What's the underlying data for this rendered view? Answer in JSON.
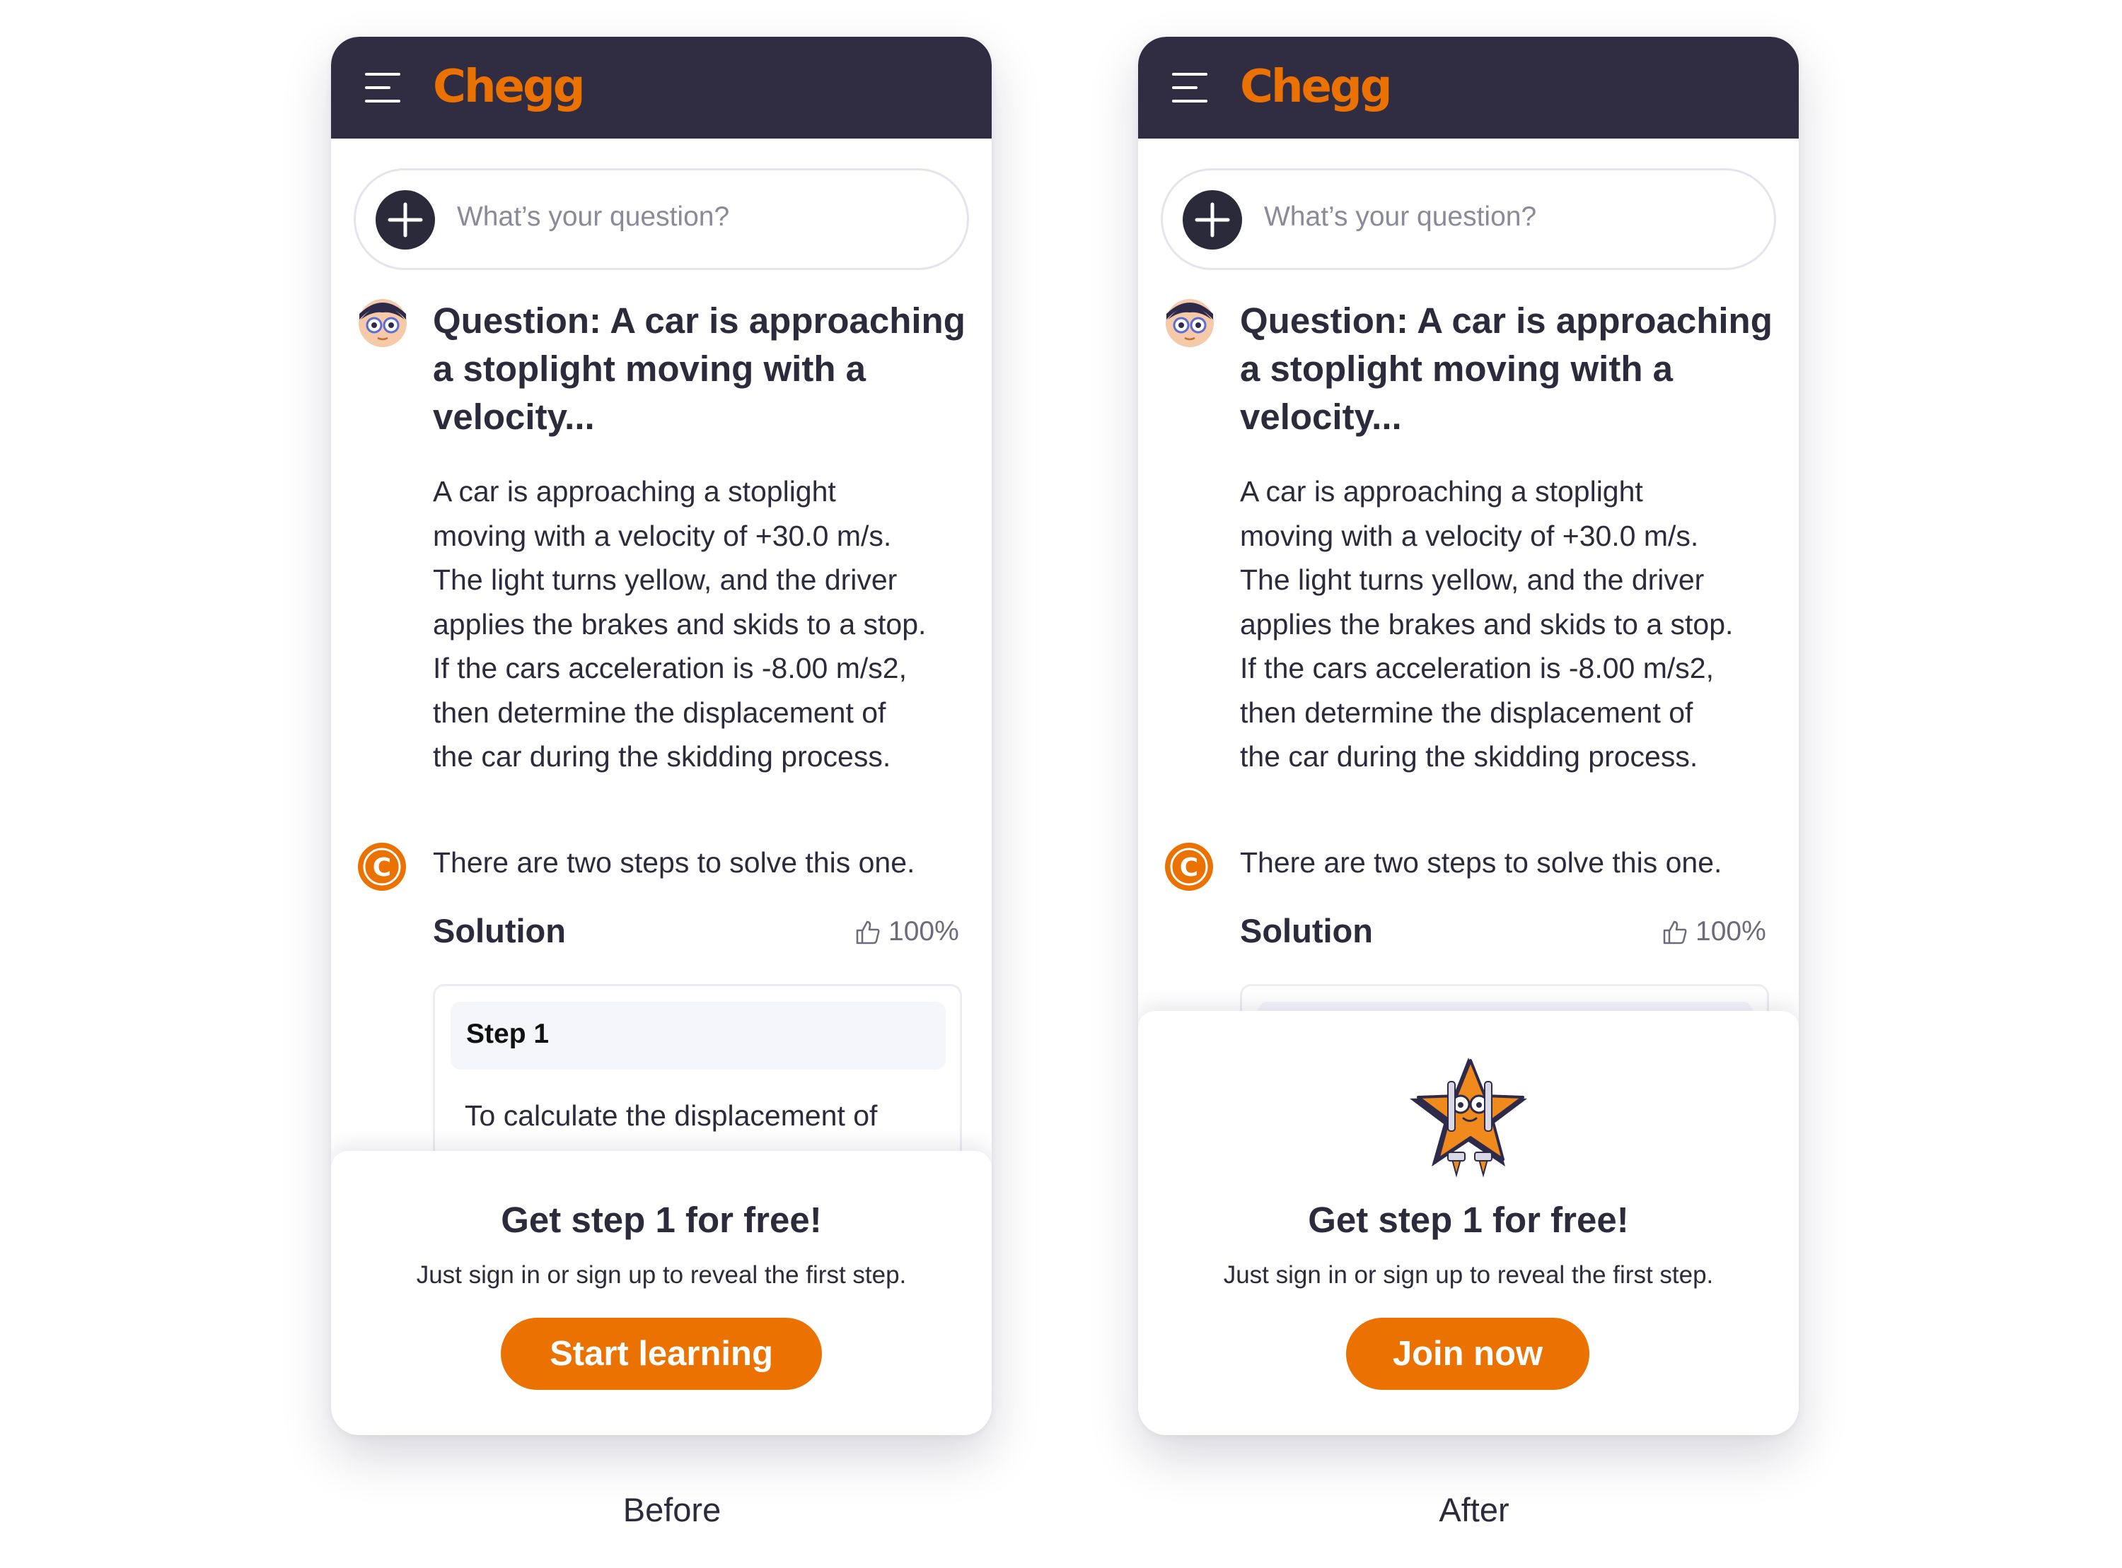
{
  "colors": {
    "header_bg": "#302d43",
    "brand_orange": "#eb7100",
    "text": "#2b2b3b",
    "muted": "#8a8a99"
  },
  "icons": [
    "menu-icon",
    "plus-icon",
    "student-avatar-icon",
    "chegg-c-icon",
    "thumbs-up-icon",
    "star-mascot-icon"
  ],
  "header": {
    "logo": "Chegg"
  },
  "search": {
    "placeholder": "What’s your question?"
  },
  "question": {
    "title": "Question: A car is approaching a stoplight moving with a velocity...",
    "body": "A car is approaching a stoplight\nmoving with a velocity of +30.0 m/s.\nThe light turns yellow, and the driver\napplies the brakes and skids to a stop.\nIf the cars  acceleration is -8.00 m/s2,\nthen determine the displacement of\nthe car during the skidding process."
  },
  "answer": {
    "intro": "There are two steps to solve this one.",
    "solution_title": "Solution",
    "rating": "100%",
    "step_label": "Step 1",
    "step_text": "To calculate the displacement of"
  },
  "before": {
    "cta_title": "Get step 1 for free!",
    "cta_sub": "Just sign in or sign up to reveal the first step.",
    "cta_button": "Start learning",
    "caption": "Before"
  },
  "after": {
    "cta_title": "Get step 1 for free!",
    "cta_sub": "Just sign in or sign up to reveal the first step.",
    "cta_button": "Join now",
    "caption": "After"
  }
}
